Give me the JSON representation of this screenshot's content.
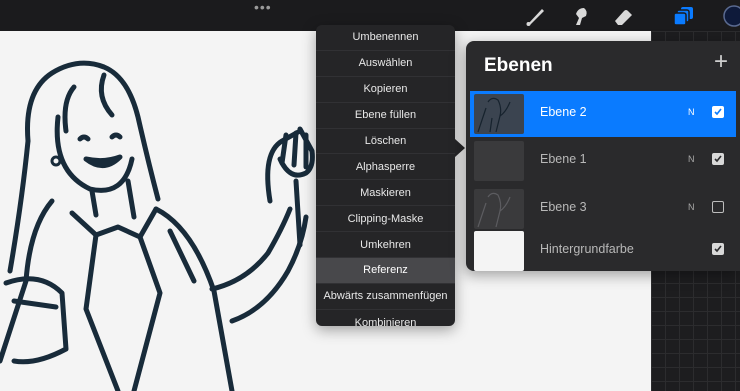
{
  "toolbar": {
    "grip": "•••",
    "tools": [
      "brush-icon",
      "smudge-icon",
      "eraser-icon",
      "layers-icon",
      "color-icon"
    ],
    "accent": "#0a7bff"
  },
  "context_menu": {
    "items": [
      {
        "label": "Umbenennen"
      },
      {
        "label": "Auswählen"
      },
      {
        "label": "Kopieren"
      },
      {
        "label": "Ebene füllen"
      },
      {
        "label": "Löschen"
      },
      {
        "label": "Alphasperre"
      },
      {
        "label": "Maskieren"
      },
      {
        "label": "Clipping-Maske"
      },
      {
        "label": "Umkehren"
      },
      {
        "label": "Referenz",
        "selected": true
      },
      {
        "label": "Abwärts zusammenfügen"
      },
      {
        "label": "Kombinieren"
      }
    ]
  },
  "layers_panel": {
    "title": "Ebenen",
    "add_label": "+",
    "layers": [
      {
        "name": "Ebene 2",
        "blend": "N",
        "visible": true,
        "active": true
      },
      {
        "name": "Ebene 1",
        "blend": "N",
        "visible": true,
        "active": false
      },
      {
        "name": "Ebene 3",
        "blend": "N",
        "visible": false,
        "active": false
      },
      {
        "name": "Hintergrundfarbe",
        "blend": "",
        "visible": true,
        "active": false
      }
    ]
  }
}
